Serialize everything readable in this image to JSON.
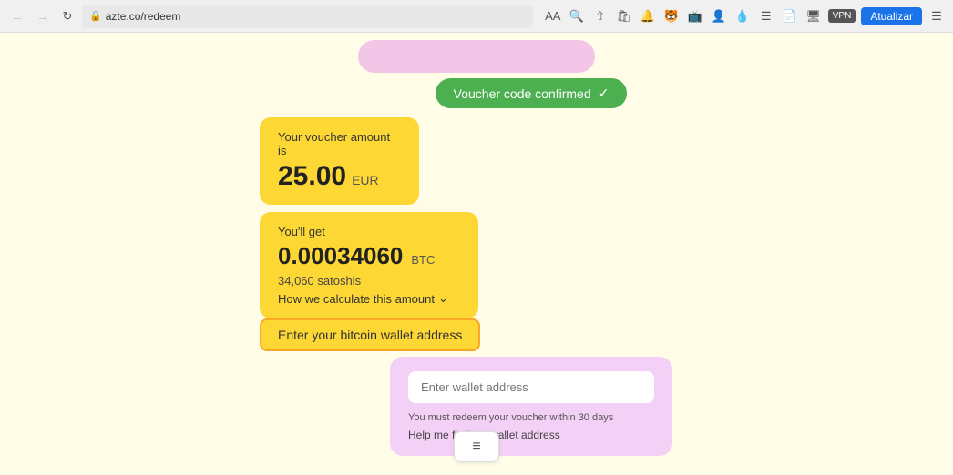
{
  "browser": {
    "url": "azte.co/redeem",
    "back_disabled": true,
    "forward_disabled": true,
    "update_label": "Atualizar",
    "vpn_label": "VPN"
  },
  "page": {
    "pink_bubble_text": "",
    "voucher_confirmed_label": "Voucher code confirmed",
    "voucher_amount_label": "Your voucher amount is",
    "voucher_amount": "25.00",
    "voucher_currency": "EUR",
    "youll_get_label": "You'll get",
    "btc_amount": "0.00034060",
    "btc_unit": "BTC",
    "satoshis_label": "34,060 satoshis",
    "calculate_label": "How we calculate this amount",
    "wallet_btn_label": "Enter your bitcoin wallet address",
    "wallet_input_placeholder": "Enter wallet address",
    "wallet_note": "You must redeem your voucher within 30 days",
    "wallet_help": "Help me find my wallet address",
    "menu_icon": "≡"
  }
}
